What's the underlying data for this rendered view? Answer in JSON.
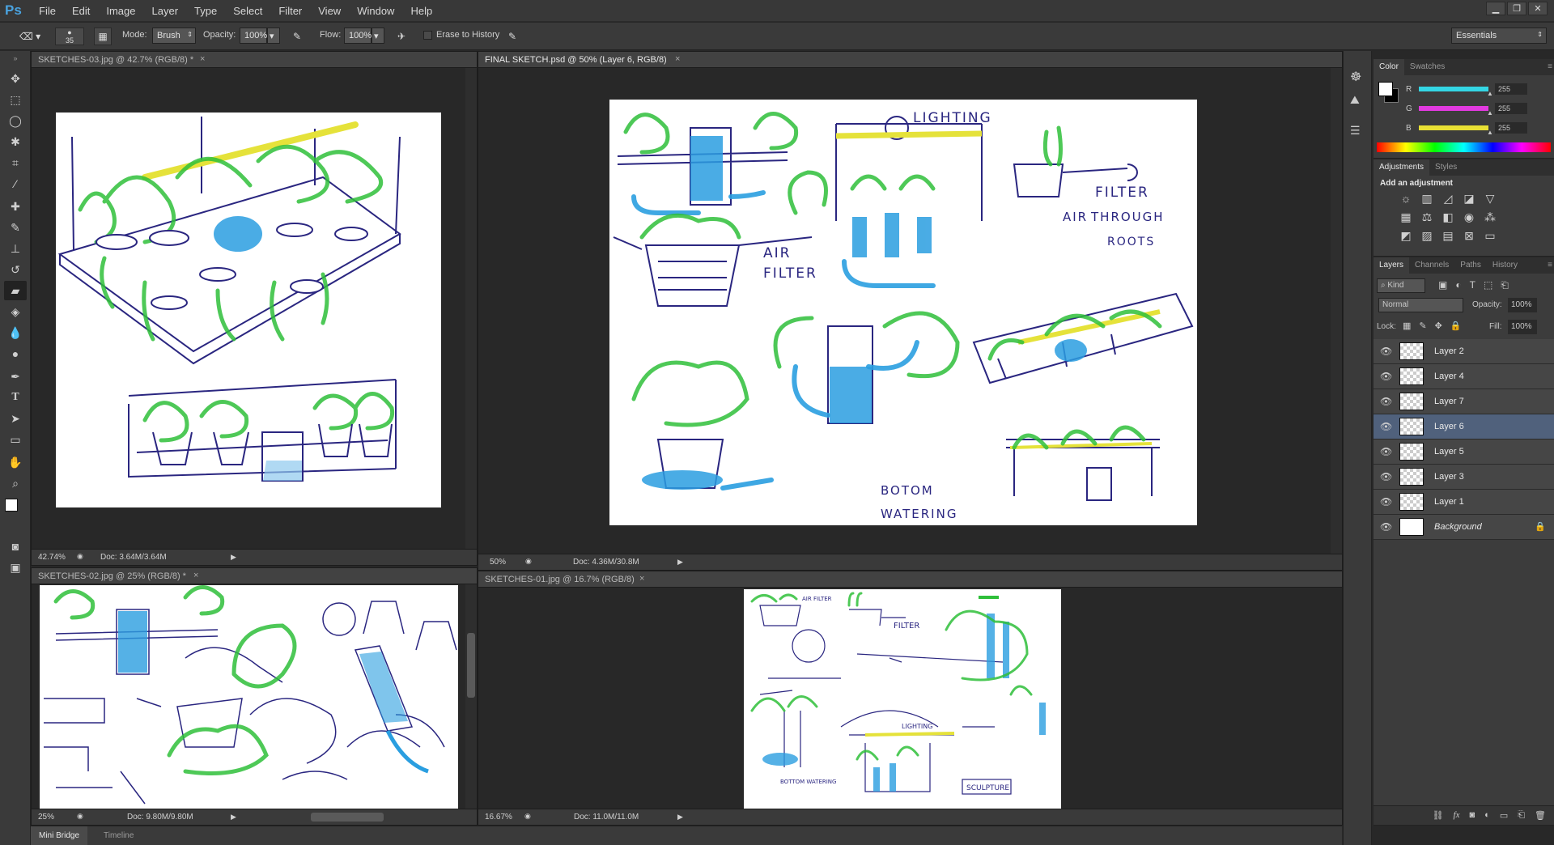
{
  "app": {
    "logo": "Ps"
  },
  "menu": [
    "File",
    "Edit",
    "Image",
    "Layer",
    "Type",
    "Select",
    "Filter",
    "View",
    "Window",
    "Help"
  ],
  "window_controls": {
    "minimize": "▁",
    "restore": "❐",
    "close": "✕"
  },
  "options": {
    "brush_size": "35",
    "mode_label": "Mode:",
    "mode_value": "Brush",
    "opacity_label": "Opacity:",
    "opacity_value": "100%",
    "flow_label": "Flow:",
    "flow_value": "100%",
    "erase_history": "Erase to History",
    "workspace": "Essentials"
  },
  "documents": [
    {
      "title": "SKETCHES-03.jpg @ 42.7% (RGB/8) *",
      "zoom": "42.74%",
      "doc": "Doc: 3.64M/3.64M"
    },
    {
      "title": "FINAL SKETCH.psd @ 50% (Layer 6, RGB/8)",
      "zoom": "50%",
      "doc": "Doc: 4.36M/30.8M"
    },
    {
      "title": "SKETCHES-02.jpg @ 25% (RGB/8) *",
      "zoom": "25%",
      "doc": "Doc: 9.80M/9.80M"
    },
    {
      "title": "SKETCHES-01.jpg @ 16.7% (RGB/8)",
      "zoom": "16.67%",
      "doc": "Doc: 11.0M/11.0M"
    }
  ],
  "sketch_text": {
    "lighting": "LIGHTING",
    "air_filter_1": "AIR",
    "air_filter_2": "FILTER",
    "filter_1": "FILTER",
    "filter_2": "THROUGH",
    "filter_3": "ROOTS",
    "filter_air": "AIR",
    "bottom_1": "BOTOM",
    "bottom_2": "WATERING",
    "sculpture": "SCULPTURE",
    "s1_air": "AIR FILTER",
    "s1_filter": "FILTER",
    "s1_lighting": "LIGHTING",
    "s1_bottom": "BOTTOM WATERING"
  },
  "color_panel": {
    "tabs": [
      "Color",
      "Swatches"
    ],
    "channels": [
      {
        "label": "R",
        "value": "255",
        "color": "#34d6e4"
      },
      {
        "label": "G",
        "value": "255",
        "color": "#e23adf"
      },
      {
        "label": "B",
        "value": "255",
        "color": "#e8e034"
      }
    ]
  },
  "adjust_panel": {
    "tabs": [
      "Adjustments",
      "Styles"
    ],
    "heading": "Add an adjustment"
  },
  "layers_panel": {
    "tabs": [
      "Layers",
      "Channels",
      "Paths",
      "History"
    ],
    "filter": "Kind",
    "blend": "Normal",
    "opacity_label": "Opacity:",
    "opacity_value": "100%",
    "lock_label": "Lock:",
    "fill_label": "Fill:",
    "fill_value": "100%",
    "layers": [
      "Layer 2",
      "Layer 4",
      "Layer 7",
      "Layer 6",
      "Layer 5",
      "Layer 3",
      "Layer 1",
      "Background"
    ],
    "selected": "Layer 6"
  },
  "bottom_tabs": [
    "Mini Bridge",
    "Timeline"
  ]
}
